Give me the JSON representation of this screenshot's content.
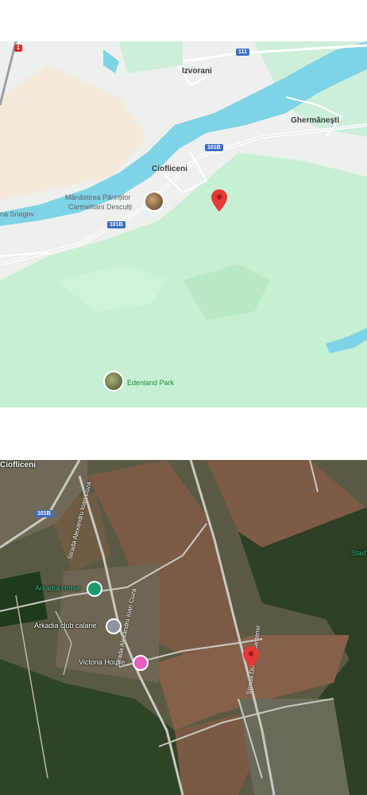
{
  "map": {
    "labels": {
      "izvorani": "Izvorani",
      "ghermanesti": "Ghermănești",
      "ciofliceni": "Ciofliceni",
      "monastery_line1": "Mânăstirea Părinților",
      "monastery_line2": "Carmelitani Desculți",
      "snagov": "na Snagov",
      "edenland": "Edenland Park"
    },
    "road_shields": {
      "r111": "111",
      "r101b_a": "101B",
      "r101b_b": "101B",
      "r1": "1"
    },
    "colors": {
      "water": "#7fd3e6",
      "forest": "#c5efd6",
      "pin": "#e53935",
      "road": "#ffffff"
    }
  },
  "satellite": {
    "labels": {
      "ciofliceni": "Ciofliceni",
      "arkadia_horse": "Arkadia Horse",
      "arkadia_club": "Arkadia club calarie",
      "victoria_house": "Victoria House",
      "stad": "Stad",
      "street_a": "Strada Alexandru Ioan Cuza",
      "street_b": "Strada Alexandru Ioan Cuza",
      "street_c": "Strada Dimitrie Cantemir"
    },
    "road_shields": {
      "r101b": "101B"
    },
    "colors": {
      "field": "#7a5a45",
      "forest": "#2f4426",
      "pin": "#e53935"
    }
  }
}
